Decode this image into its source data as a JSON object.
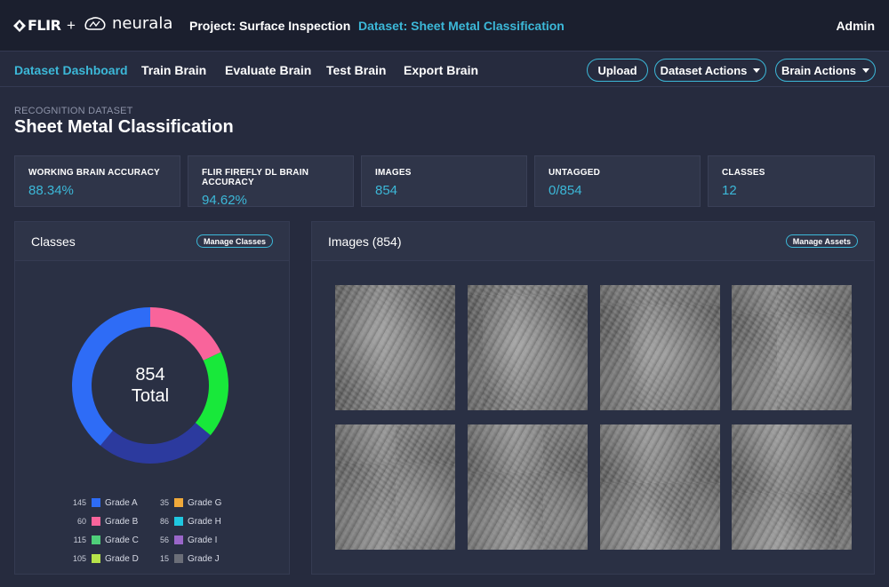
{
  "header": {
    "flir_logo": "FLIR",
    "plus": "+",
    "neurala_logo": "neurala",
    "project": "Project: Surface Inspection",
    "dataset": "Dataset: Sheet Metal Classification",
    "user": "Admin"
  },
  "nav": {
    "tabs": [
      {
        "label": "Dataset Dashboard"
      },
      {
        "label": "Train Brain"
      },
      {
        "label": "Evaluate Brain"
      },
      {
        "label": "Test Brain"
      },
      {
        "label": "Export Brain"
      }
    ],
    "upload": "Upload",
    "dataset_actions": "Dataset Actions",
    "brain_actions": "Brain Actions"
  },
  "page": {
    "subtitle": "RECOGNITION DATASET",
    "title": "Sheet Metal Classification"
  },
  "stats": [
    {
      "label": "WORKING BRAIN ACCURACY",
      "value": "88.34%"
    },
    {
      "label": "FLIR FIREFLY DL BRAIN ACCURACY",
      "value": "94.62%"
    },
    {
      "label": "IMAGES",
      "value": "854"
    },
    {
      "label": "UNTAGGED",
      "value": "0/854"
    },
    {
      "label": "CLASSES",
      "value": "12"
    }
  ],
  "classes_card": {
    "title": "Classes",
    "manage": "Manage Classes",
    "total_number": "854",
    "total_label": "Total"
  },
  "images_card": {
    "title": "Images (854)",
    "manage": "Manage Assets",
    "thumbnail_count": 8
  },
  "colors": {
    "accent": "#3cb8d8",
    "grade_a": "#2e6cf6",
    "grade_b": "#f9649b",
    "grade_c": "#18e83a",
    "grade_d": "#2c3a9e"
  },
  "chart_data": {
    "type": "pie",
    "style": "donut",
    "categories": [
      "Grade A",
      "Grade B",
      "Grade C",
      "Grade D",
      "Grade G",
      "Grade H",
      "Grade I",
      "Grade J"
    ],
    "values": [
      145,
      60,
      115,
      105,
      35,
      86,
      56,
      15
    ],
    "legend": [
      {
        "count": "145",
        "name": "Grade A",
        "color": "#2e6cf6"
      },
      {
        "count": "60",
        "name": "Grade B",
        "color": "#f9649b"
      },
      {
        "count": "115",
        "name": "Grade C",
        "color": "#4fcf7a"
      },
      {
        "count": "105",
        "name": "Grade D",
        "color": "#b7e34a"
      },
      {
        "count": "35",
        "name": "Grade G",
        "color": "#f0a93a"
      },
      {
        "count": "86",
        "name": "Grade H",
        "color": "#1fc7e0"
      },
      {
        "count": "56",
        "name": "Grade I",
        "color": "#9a66c9"
      },
      {
        "count": "15",
        "name": "Grade J",
        "color": "#6b6e78"
      }
    ],
    "donut_segments": [
      {
        "name": "Grade A",
        "color": "#2e6cf6",
        "fraction": 0.39
      },
      {
        "name": "Grade B",
        "color": "#f9649b",
        "fraction": 0.18
      },
      {
        "name": "Grade C",
        "color": "#18e83a",
        "fraction": 0.18
      },
      {
        "name": "Grade D",
        "color": "#2c3a9e",
        "fraction": 0.25
      }
    ],
    "legend_placement": "bottom"
  }
}
